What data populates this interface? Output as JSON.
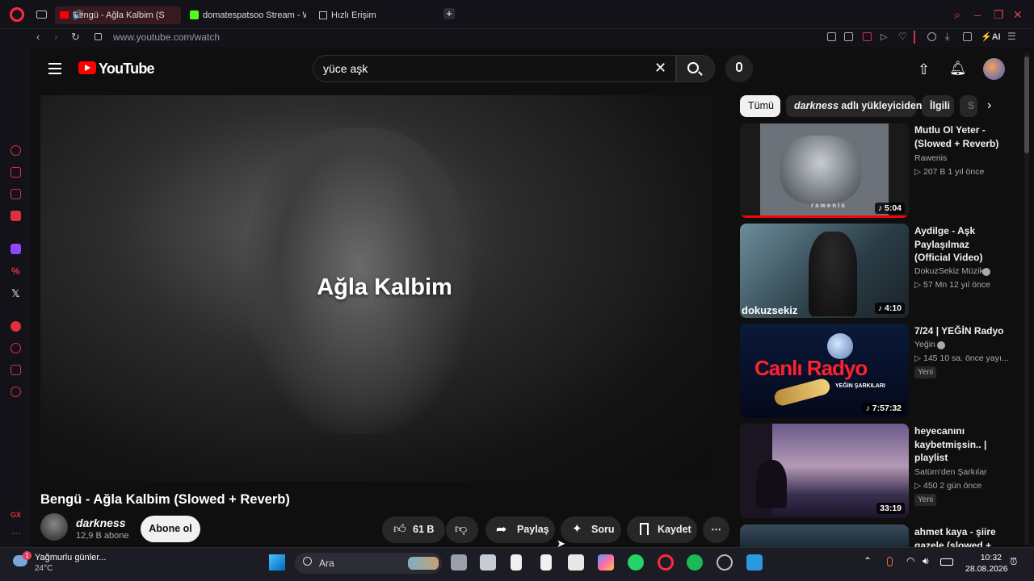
{
  "browser": {
    "tabs": [
      {
        "label": "Bengü - Ağla Kalbim (S"
      },
      {
        "label": "domatespatsoo Stream - W"
      },
      {
        "label": "Hızlı Erişim"
      }
    ],
    "url": "www.youtube.com/watch",
    "accent": "#ff2a3c"
  },
  "youtube": {
    "logo_text": "YouTube",
    "search_value": "yüce aşk",
    "player_overlay_text": "Ağla Kalbim",
    "video_title": "Bengü - Ağla Kalbim (Slowed + Reverb)",
    "channel_name": "darkness",
    "channel_subs": "12,9 B abone",
    "subscribe_label": "Abone ol",
    "like_count": "61 B",
    "share_label": "Paylaş",
    "ask_label": "Soru",
    "save_label": "Kaydet",
    "chips": {
      "all": "Tümü",
      "uploader_name": "darkness",
      "uploader_suffix": " adlı yükleyiciden",
      "related": "İlgili",
      "more": "S"
    },
    "recommendations": [
      {
        "title": "Mutlu Ol Yeter - (Slowed + Reverb)",
        "channel": "Rawenis",
        "meta": "▷ 207 B   1 yıl önce",
        "duration": "♪ 5:04",
        "thumb_text": "rawenis",
        "badge": "",
        "watched": 1.0
      },
      {
        "title": "Aydilge - Aşk Paylaşılmaz (Official Video)",
        "channel": "DokuzSekiz Müzik",
        "meta": "▷ 57 Mn   12 yıl önce",
        "duration": "♪ 4:10",
        "thumb_text": "dokuzsekiz",
        "badge": "",
        "watched": 0.0
      },
      {
        "title": "7/24 | YEĞİN Radyo",
        "channel": "Yeğin",
        "meta": "▷ 145   10 sa. önce yayı...",
        "duration": "♪ 7:57:32",
        "thumb_text": "Canlı Radyo",
        "thumb_sub": "YEĞİN ŞARKILARI",
        "badge": "Yeni",
        "watched": 0.0
      },
      {
        "title": "heyecanını kaybetmişsin.. | playlist",
        "channel": "Satürn'den Şarkılar",
        "meta": "▷ 450   2 gün önce",
        "duration": "33:19",
        "thumb_text": "",
        "badge": "Yeni",
        "watched": 0.0
      },
      {
        "title": "ahmet kaya - şiire gazele (slowed +",
        "channel": "",
        "meta": "",
        "duration": "",
        "thumb_text": "",
        "badge": "",
        "watched": 0.0
      }
    ]
  },
  "taskbar": {
    "weather_text": "Yağmurlu günler...",
    "temperature": "24°C",
    "weather_badge": "1",
    "search_placeholder": "Ara",
    "time": "10:32",
    "date": "28.08.2026"
  }
}
